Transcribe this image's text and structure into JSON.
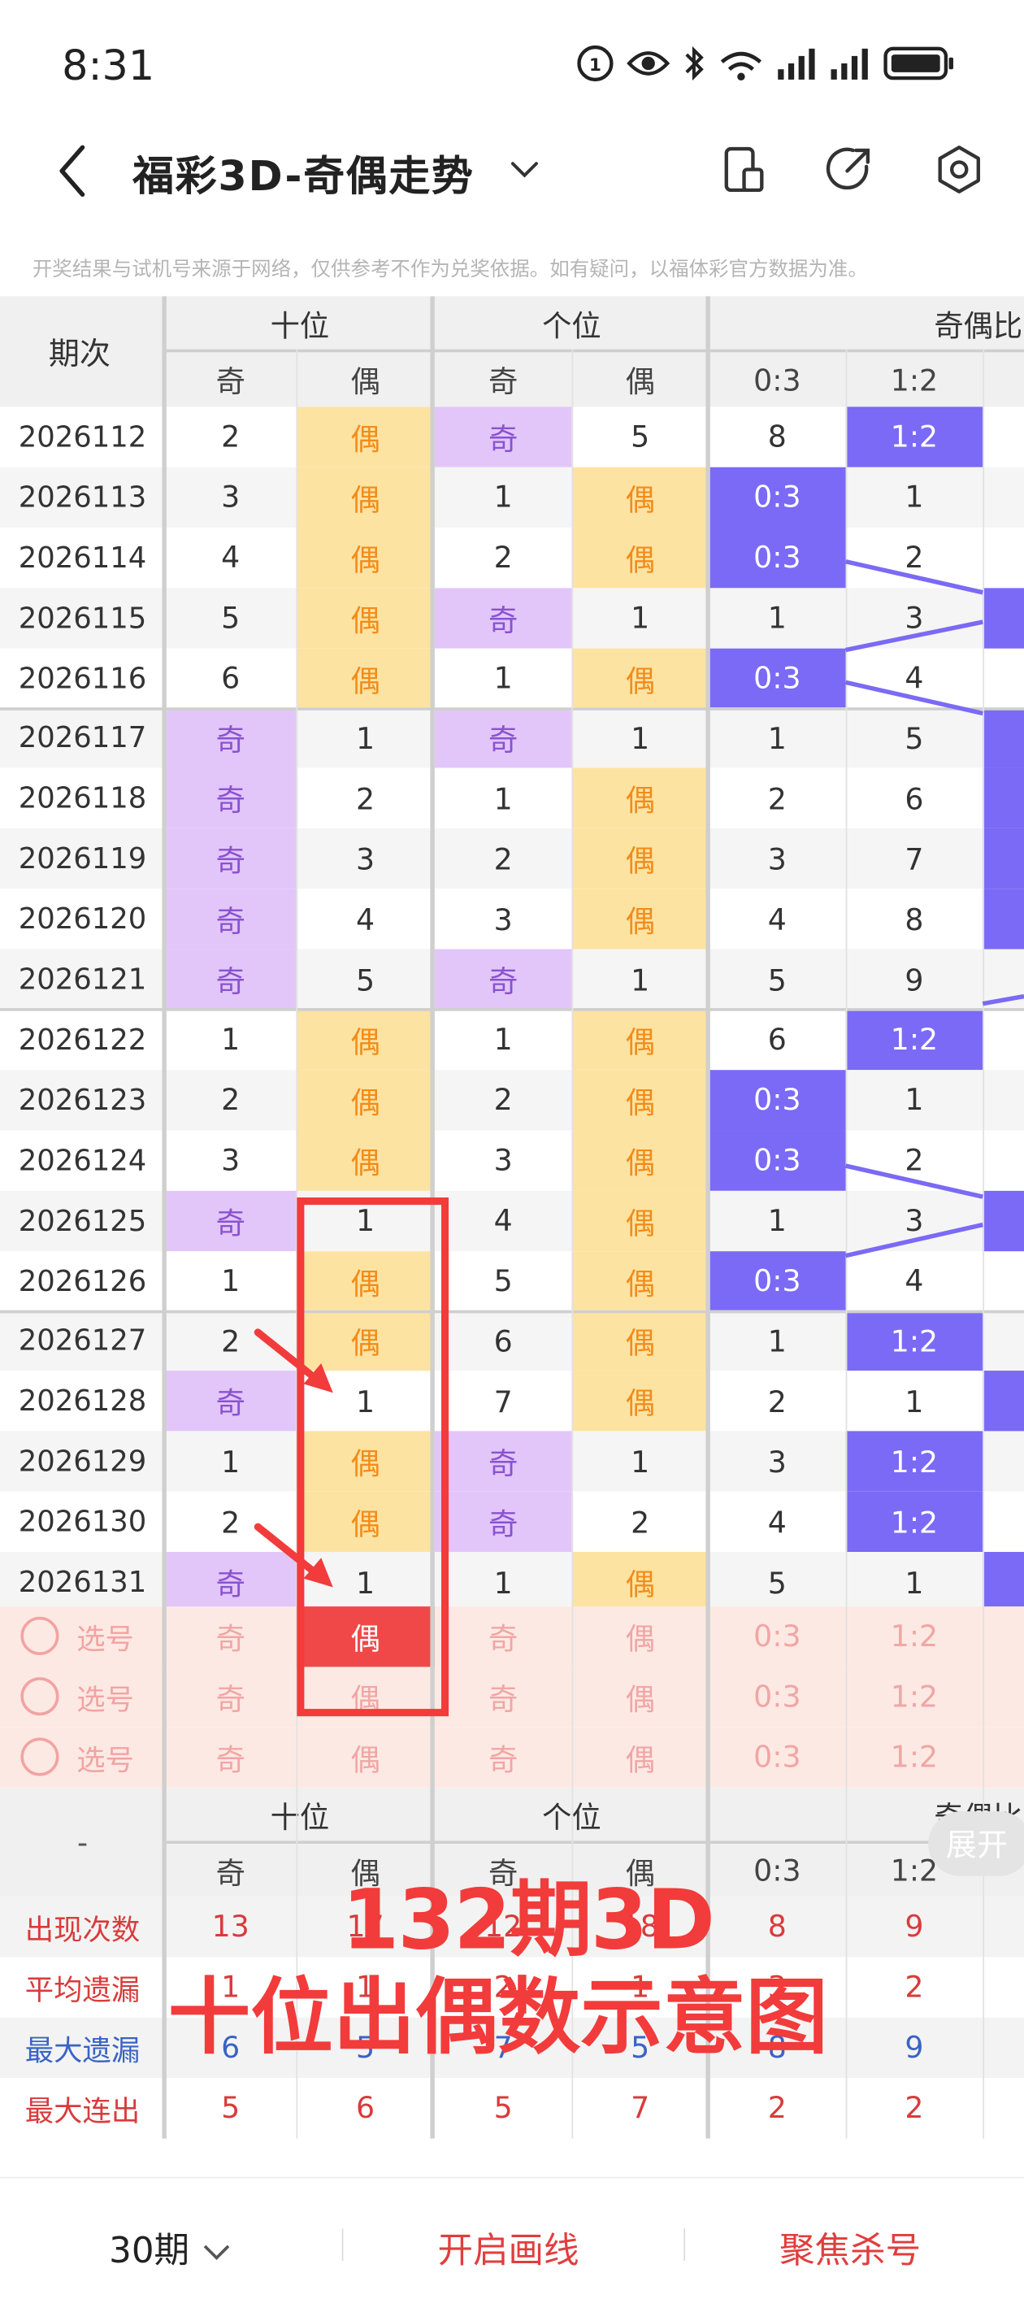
{
  "status_bar": {
    "time": "8:31"
  },
  "header": {
    "title": "福彩3D-奇偶走势"
  },
  "notice": "开奖结果与试机号来源于网络，仅供参考不作为兑奖依据。如有疑问，以福体彩官方数据为准。",
  "table": {
    "period_header": "期次",
    "groups": [
      "十位",
      "个位",
      "奇偶比"
    ],
    "subheaders": [
      "奇",
      "偶",
      "奇",
      "偶",
      "0:3",
      "1:2"
    ],
    "rows": [
      {
        "period": "2026112",
        "cells": [
          "2",
          "偶",
          "奇",
          "5",
          "8",
          "1:2"
        ]
      },
      {
        "period": "2026113",
        "cells": [
          "3",
          "偶",
          "1",
          "偶",
          "0:3",
          "1"
        ]
      },
      {
        "period": "2026114",
        "cells": [
          "4",
          "偶",
          "2",
          "偶",
          "0:3",
          "2"
        ]
      },
      {
        "period": "2026115",
        "cells": [
          "5",
          "偶",
          "奇",
          "1",
          "1",
          "3"
        ]
      },
      {
        "period": "2026116",
        "cells": [
          "6",
          "偶",
          "1",
          "偶",
          "0:3",
          "4"
        ]
      },
      {
        "period": "2026117",
        "cells": [
          "奇",
          "1",
          "奇",
          "1",
          "1",
          "5"
        ]
      },
      {
        "period": "2026118",
        "cells": [
          "奇",
          "2",
          "1",
          "偶",
          "2",
          "6"
        ]
      },
      {
        "period": "2026119",
        "cells": [
          "奇",
          "3",
          "2",
          "偶",
          "3",
          "7"
        ]
      },
      {
        "period": "2026120",
        "cells": [
          "奇",
          "4",
          "3",
          "偶",
          "4",
          "8"
        ]
      },
      {
        "period": "2026121",
        "cells": [
          "奇",
          "5",
          "奇",
          "1",
          "5",
          "9"
        ]
      },
      {
        "period": "2026122",
        "cells": [
          "1",
          "偶",
          "1",
          "偶",
          "6",
          "1:2"
        ]
      },
      {
        "period": "2026123",
        "cells": [
          "2",
          "偶",
          "2",
          "偶",
          "0:3",
          "1"
        ]
      },
      {
        "period": "2026124",
        "cells": [
          "3",
          "偶",
          "3",
          "偶",
          "0:3",
          "2"
        ]
      },
      {
        "period": "2026125",
        "cells": [
          "奇",
          "1",
          "4",
          "偶",
          "1",
          "3"
        ]
      },
      {
        "period": "2026126",
        "cells": [
          "1",
          "偶",
          "5",
          "偶",
          "0:3",
          "4"
        ]
      },
      {
        "period": "2026127",
        "cells": [
          "2",
          "偶",
          "6",
          "偶",
          "1",
          "1:2"
        ]
      },
      {
        "period": "2026128",
        "cells": [
          "奇",
          "1",
          "7",
          "偶",
          "2",
          "1"
        ]
      },
      {
        "period": "2026129",
        "cells": [
          "1",
          "偶",
          "奇",
          "1",
          "3",
          "1:2"
        ]
      },
      {
        "period": "2026130",
        "cells": [
          "2",
          "偶",
          "奇",
          "2",
          "4",
          "1:2"
        ]
      },
      {
        "period": "2026131",
        "cells": [
          "奇",
          "1",
          "1",
          "偶",
          "5",
          "1"
        ]
      }
    ],
    "pick_rows": [
      {
        "label": "选号",
        "cells": [
          "奇",
          "偶",
          "奇",
          "偶",
          "0:3",
          "1:2"
        ]
      },
      {
        "label": "选号",
        "cells": [
          "奇",
          "偶",
          "奇",
          "偶",
          "0:3",
          "1:2"
        ]
      },
      {
        "label": "选号",
        "cells": [
          "奇",
          "偶",
          "奇",
          "偶",
          "0:3",
          "1:2"
        ]
      }
    ],
    "footer_groups": [
      "十位",
      "个位",
      "奇偶比"
    ],
    "footer_dash": "-",
    "footer_subheaders": [
      "奇",
      "偶",
      "奇",
      "偶",
      "0:3",
      "1:2"
    ],
    "stats": [
      {
        "label": "出现次数",
        "cells": [
          "13",
          "17",
          "12",
          "18",
          "8",
          "9"
        ]
      },
      {
        "label": "平均遗漏",
        "cells": [
          "1",
          "1",
          "2",
          "1",
          "3",
          "2"
        ]
      },
      {
        "label": "最大遗漏",
        "cells": [
          "6",
          "5",
          "7",
          "5",
          "8",
          "9"
        ]
      },
      {
        "label": "最大连出",
        "cells": [
          "5",
          "6",
          "5",
          "7",
          "2",
          "2"
        ]
      }
    ],
    "expand_label": "展开"
  },
  "overlay": {
    "line1": "132期3D",
    "line2": "十位出偶数示意图"
  },
  "bottom_bar": {
    "period_select": "30期",
    "draw_line": "开启画线",
    "focus_kill": "聚焦杀号"
  },
  "colors": {
    "odd": "#e2c6fa",
    "odd_text": "#8a52d0",
    "even": "#fde3a2",
    "even_text": "#f28c1a",
    "ratio_fill": "#7a6af5",
    "annotation_red": "#f23b3b",
    "pick_row_bg": "#fde9e3",
    "stat_red": "#d93b3b",
    "stat_blue": "#3a63c4"
  }
}
